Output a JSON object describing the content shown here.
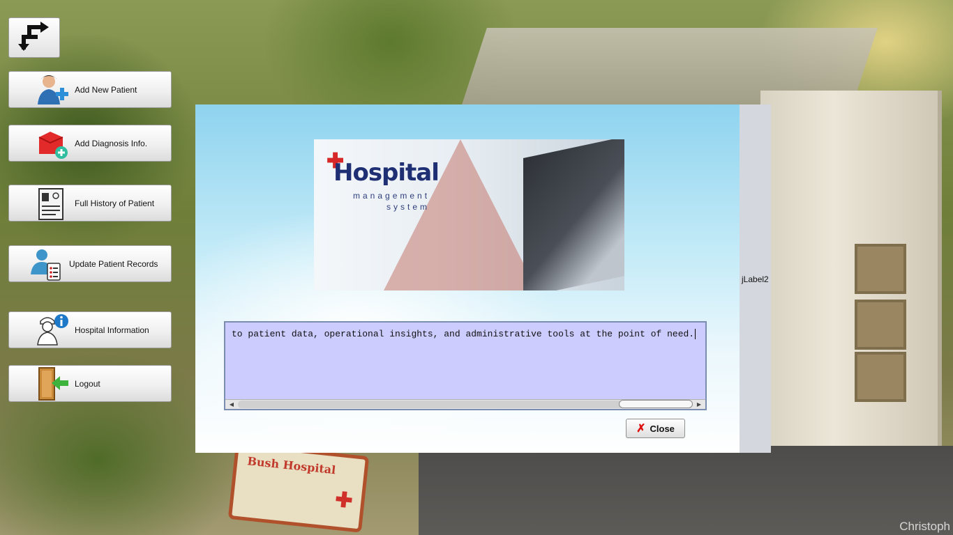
{
  "sidebar": {
    "items": [
      {
        "label": "Add New Patient",
        "icon": "add-patient-icon"
      },
      {
        "label": "Add Diagnosis Info.",
        "icon": "add-diagnosis-icon"
      },
      {
        "label": "Full History of Patient",
        "icon": "patient-history-icon"
      },
      {
        "label": "Update Patient Records",
        "icon": "update-records-icon"
      },
      {
        "label": "Hospital Information",
        "icon": "hospital-info-icon"
      },
      {
        "label": "Logout",
        "icon": "logout-door-icon"
      }
    ],
    "back_icon": "switch-arrows-icon"
  },
  "dialog": {
    "banner": {
      "title": "Hospital",
      "subtitle_line1": "management",
      "subtitle_line2": "system"
    },
    "info_text": "to patient data, operational insights, and administrative tools at the point of need.",
    "side_label": "jLabel2",
    "close_label": "Close"
  },
  "background": {
    "sign_text": "Bush Hospital",
    "watermark": "Christoph"
  },
  "colors": {
    "textarea_bg": "#ccccff",
    "close_icon": "#d11111",
    "accent_blue": "#1f2f73"
  }
}
